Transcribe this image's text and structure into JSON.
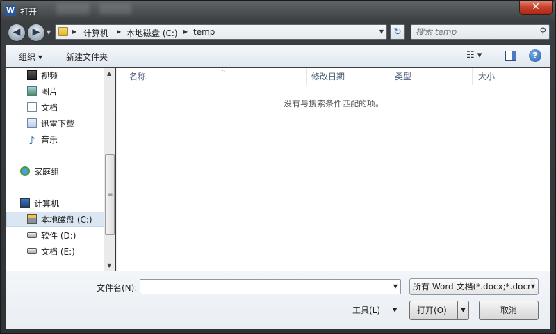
{
  "titlebar": {
    "title": "打开",
    "app_icon": "W",
    "close_glyph": "✕"
  },
  "nav": {
    "back_glyph": "◀",
    "forward_glyph": "▶",
    "history_glyph": "▼",
    "breadcrumbs": [
      "计算机",
      "本地磁盘 (C:)",
      "temp"
    ],
    "sep_glyph": "▶",
    "dropdown_glyph": "▼",
    "refresh_glyph": "↻",
    "search_placeholder": "搜索 temp",
    "search_glyph": "⚲"
  },
  "toolbar": {
    "organize": "组织 ▾",
    "new_folder": "新建文件夹",
    "views": "☷ ▾",
    "help": "?"
  },
  "sidebar": {
    "libraries": [
      {
        "label": "视频",
        "icon": "video-icon"
      },
      {
        "label": "图片",
        "icon": "pictures-icon"
      },
      {
        "label": "文档",
        "icon": "documents-icon"
      },
      {
        "label": "迅雷下载",
        "icon": "download-icon"
      },
      {
        "label": "音乐",
        "icon": "music-icon"
      }
    ],
    "homegroup": "家庭组",
    "computer": "计算机",
    "drives": [
      "本地磁盘 (C:)",
      "软件 (D:)",
      "文档 (E:)"
    ],
    "scroll_up": "▲",
    "scroll_down": "▼",
    "grip": "≡"
  },
  "columns": [
    "名称",
    "修改日期",
    "类型",
    "大小"
  ],
  "sort_glyph": "^",
  "empty_message": "没有与搜索条件匹配的项。",
  "footer": {
    "filename_label": "文件名(N):",
    "filename_value": "",
    "dd_glyph": "▼",
    "filter_value": "所有 Word 文档(*.docx;*.docm",
    "tools_label": "工具(L)",
    "open_label": "打开(O)",
    "cancel_label": "取消"
  }
}
